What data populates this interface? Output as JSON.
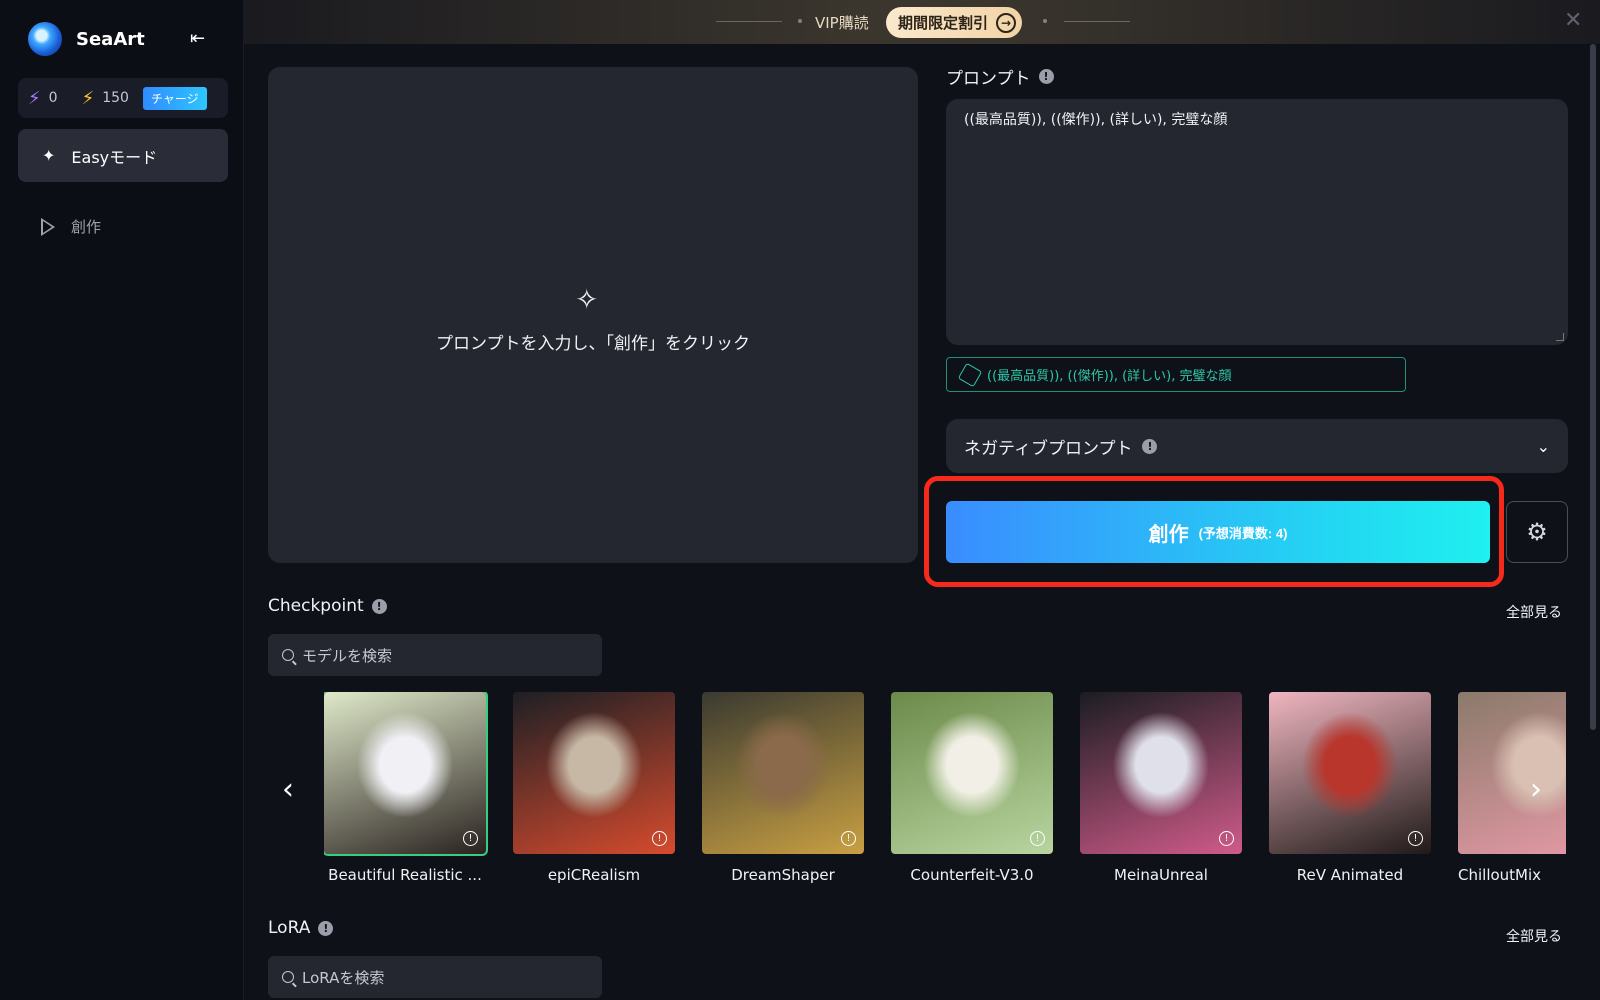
{
  "sidebar": {
    "brand": "SeaArt",
    "credits": {
      "purple_count": "0",
      "yellow_count": "150",
      "charge_label": "チャージ"
    },
    "nav": [
      {
        "label": "Easyモード",
        "active": true
      },
      {
        "label": "創作",
        "active": false
      }
    ]
  },
  "banner": {
    "vip_label": "VIP購読",
    "promo_label": "期間限定割引"
  },
  "preview": {
    "hint": "プロンプトを入力し、「創作」をクリック"
  },
  "prompt": {
    "label": "プロンプト",
    "value": "((最高品質)), ((傑作)), (詳しい), 完璧な顔",
    "suggestion": "((最高品質)), ((傑作)), (詳しい), 完璧な顔"
  },
  "negative": {
    "label": "ネガティブプロンプト"
  },
  "create": {
    "label": "創作",
    "cost": "(予想消費数: 4)"
  },
  "checkpoint": {
    "label": "Checkpoint",
    "see_all": "全部見る",
    "search_placeholder": "モデルを検索",
    "models": [
      {
        "name": "Beautiful Realistic ...",
        "colors": [
          "#dfe9c9",
          "#f0f0f5",
          "#2a2220"
        ]
      },
      {
        "name": "epiCRealism",
        "colors": [
          "#1d1f24",
          "#c7b7a5",
          "#d64b2e"
        ]
      },
      {
        "name": "DreamShaper",
        "colors": [
          "#3a3a30",
          "#8a6a4a",
          "#c9a043"
        ]
      },
      {
        "name": "Counterfeit-V3.0",
        "colors": [
          "#6c8a4a",
          "#f2f0e6",
          "#b8d5a0"
        ]
      },
      {
        "name": "MeinaUnreal",
        "colors": [
          "#1b1d22",
          "#dfe0ea",
          "#d05b8a"
        ]
      },
      {
        "name": "ReV Animated",
        "colors": [
          "#f0b6c0",
          "#b8362c",
          "#1f1a18"
        ]
      },
      {
        "name": "ChilloutMix",
        "colors": [
          "#8a7a6a",
          "#d9c0b2",
          "#e89aa8"
        ]
      }
    ]
  },
  "lora": {
    "label": "LoRA",
    "see_all": "全部見る",
    "search_placeholder": "LoRAを検索"
  }
}
